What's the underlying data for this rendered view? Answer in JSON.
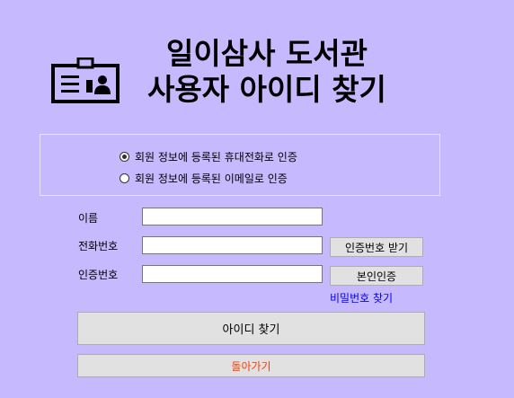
{
  "header": {
    "title_line1": "일이삼사 도서관",
    "title_line2": "사용자 아이디 찾기"
  },
  "icons": {
    "header_icon": "id-card-icon"
  },
  "verification": {
    "options": [
      {
        "label": "회원 정보에 등록된 휴대전화로 인증",
        "checked": true
      },
      {
        "label": "회원 정보에 등록된 이메일로 인증",
        "checked": false
      }
    ]
  },
  "form": {
    "name_label": "이름",
    "name_value": "",
    "phone_label": "전화번호",
    "phone_value": "",
    "code_label": "인증번호",
    "code_value": "",
    "send_code_button": "인증번호 받기",
    "verify_button": "본인인증",
    "find_password_link": "비밀번호 찾기"
  },
  "actions": {
    "find_id_button": "아이디 찾기",
    "back_button": "돌아가기"
  },
  "colors": {
    "background": "#c7b9fd",
    "link": "#0000ff",
    "back_text": "#ff3c00"
  }
}
